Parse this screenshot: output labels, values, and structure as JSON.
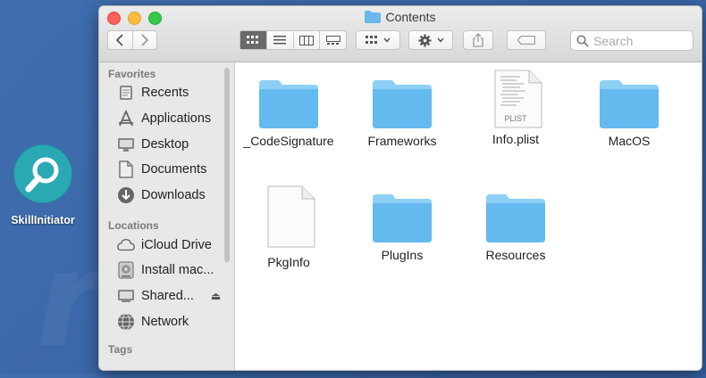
{
  "desktop": {
    "icon_label": "SkillInitiator",
    "watermark": "risk.com"
  },
  "window": {
    "title": "Contents"
  },
  "toolbar": {
    "search_placeholder": "Search"
  },
  "sidebar": {
    "favorites_header": "Favorites",
    "favorites": [
      {
        "label": "Recents",
        "icon": "clock-icon"
      },
      {
        "label": "Applications",
        "icon": "applications-icon"
      },
      {
        "label": "Desktop",
        "icon": "desktop-icon"
      },
      {
        "label": "Documents",
        "icon": "document-icon"
      },
      {
        "label": "Downloads",
        "icon": "download-icon"
      }
    ],
    "locations_header": "Locations",
    "locations": [
      {
        "label": "iCloud Drive",
        "icon": "cloud-icon"
      },
      {
        "label": "Install mac...",
        "icon": "disk-icon"
      },
      {
        "label": "Shared...",
        "icon": "monitor-icon"
      },
      {
        "label": "Network",
        "icon": "globe-icon"
      }
    ],
    "tags_header": "Tags"
  },
  "files": [
    {
      "name": "_CodeSignature",
      "kind": "folder"
    },
    {
      "name": "Frameworks",
      "kind": "folder"
    },
    {
      "name": "Info.plist",
      "kind": "plist",
      "badge": "PLIST"
    },
    {
      "name": "MacOS",
      "kind": "folder"
    },
    {
      "name": "PkgInfo",
      "kind": "document"
    },
    {
      "name": "PlugIns",
      "kind": "folder"
    },
    {
      "name": "Resources",
      "kind": "folder"
    }
  ],
  "colors": {
    "folder": "#64b9ee",
    "folder_tab": "#8dd0f6",
    "desktop_bg": "#3a66a8"
  }
}
